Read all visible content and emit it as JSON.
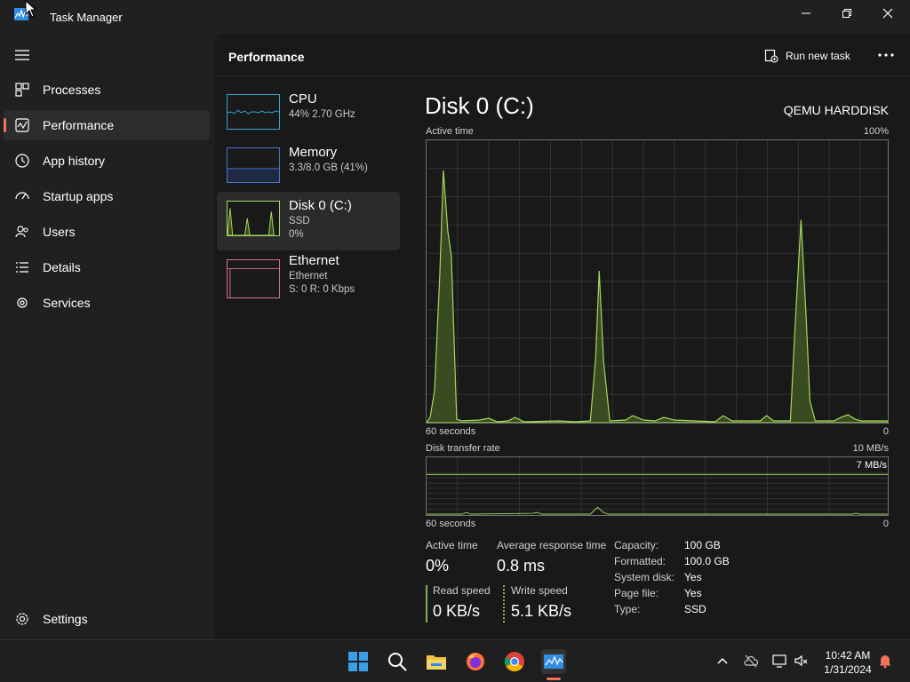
{
  "window": {
    "title": "Task Manager"
  },
  "nav": {
    "items": [
      {
        "label": "Processes"
      },
      {
        "label": "Performance"
      },
      {
        "label": "App history"
      },
      {
        "label": "Startup apps"
      },
      {
        "label": "Users"
      },
      {
        "label": "Details"
      },
      {
        "label": "Services"
      }
    ],
    "settings_label": "Settings"
  },
  "header": {
    "title": "Performance",
    "run_task_label": "Run new task"
  },
  "perf_list": [
    {
      "name": "CPU",
      "line1": "44% 2.70 GHz",
      "line2": ""
    },
    {
      "name": "Memory",
      "line1": "3.3/8.0 GB (41%)",
      "line2": ""
    },
    {
      "name": "Disk 0 (C:)",
      "line1": "SSD",
      "line2": "0%"
    },
    {
      "name": "Ethernet",
      "line1": "Ethernet",
      "line2": "S: 0 R: 0 Kbps"
    }
  ],
  "detail": {
    "title": "Disk 0 (C:)",
    "model": "QEMU HARDDISK",
    "active_time_label": "Active time",
    "active_time_max": "100%",
    "active_time_xlabel": "60 seconds",
    "active_time_xmin": "0",
    "transfer_label": "Disk transfer rate",
    "transfer_max": "10 MB/s",
    "transfer_mark": "7 MB/s",
    "transfer_xlabel": "60 seconds",
    "transfer_xmin": "0",
    "stats": {
      "active_time_label": "Active time",
      "active_time_value": "0%",
      "avg_response_label": "Average response time",
      "avg_response_value": "0.8 ms",
      "read_label": "Read speed",
      "read_value": "0 KB/s",
      "write_label": "Write speed",
      "write_value": "5.1 KB/s"
    },
    "info": [
      {
        "key": "Capacity:",
        "value": "100 GB"
      },
      {
        "key": "Formatted:",
        "value": "100.0 GB"
      },
      {
        "key": "System disk:",
        "value": "Yes"
      },
      {
        "key": "Page file:",
        "value": "Yes"
      },
      {
        "key": "Type:",
        "value": "SSD"
      }
    ]
  },
  "taskbar": {
    "time": "10:42 AM",
    "date": "1/31/2024"
  },
  "colors": {
    "disk_line": "#a6d95d",
    "disk_fill": "#3a4a21",
    "cpu_line": "#32a6d3",
    "memory_line": "#4676d3",
    "ethernet_line": "#d56f87",
    "accent": "#f0735a"
  }
}
